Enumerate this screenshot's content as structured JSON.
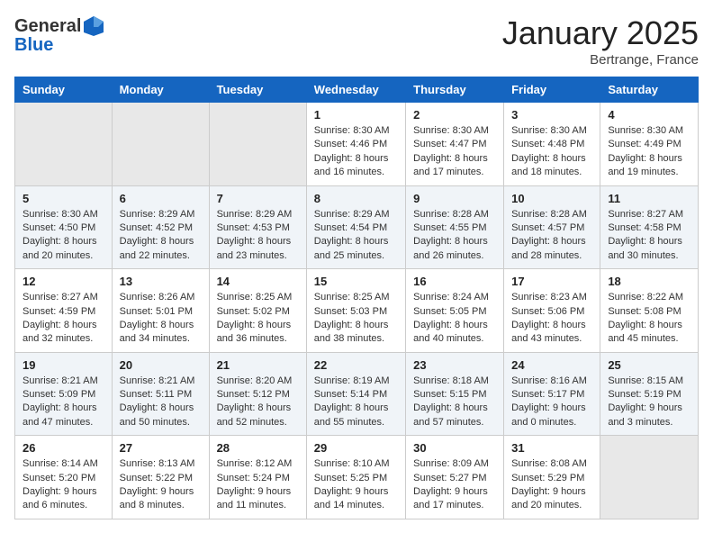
{
  "header": {
    "logo_general": "General",
    "logo_blue": "Blue",
    "month": "January 2025",
    "location": "Bertrange, France"
  },
  "weekdays": [
    "Sunday",
    "Monday",
    "Tuesday",
    "Wednesday",
    "Thursday",
    "Friday",
    "Saturday"
  ],
  "weeks": [
    [
      {
        "day": "",
        "info": ""
      },
      {
        "day": "",
        "info": ""
      },
      {
        "day": "",
        "info": ""
      },
      {
        "day": "1",
        "info": "Sunrise: 8:30 AM\nSunset: 4:46 PM\nDaylight: 8 hours\nand 16 minutes."
      },
      {
        "day": "2",
        "info": "Sunrise: 8:30 AM\nSunset: 4:47 PM\nDaylight: 8 hours\nand 17 minutes."
      },
      {
        "day": "3",
        "info": "Sunrise: 8:30 AM\nSunset: 4:48 PM\nDaylight: 8 hours\nand 18 minutes."
      },
      {
        "day": "4",
        "info": "Sunrise: 8:30 AM\nSunset: 4:49 PM\nDaylight: 8 hours\nand 19 minutes."
      }
    ],
    [
      {
        "day": "5",
        "info": "Sunrise: 8:30 AM\nSunset: 4:50 PM\nDaylight: 8 hours\nand 20 minutes."
      },
      {
        "day": "6",
        "info": "Sunrise: 8:29 AM\nSunset: 4:52 PM\nDaylight: 8 hours\nand 22 minutes."
      },
      {
        "day": "7",
        "info": "Sunrise: 8:29 AM\nSunset: 4:53 PM\nDaylight: 8 hours\nand 23 minutes."
      },
      {
        "day": "8",
        "info": "Sunrise: 8:29 AM\nSunset: 4:54 PM\nDaylight: 8 hours\nand 25 minutes."
      },
      {
        "day": "9",
        "info": "Sunrise: 8:28 AM\nSunset: 4:55 PM\nDaylight: 8 hours\nand 26 minutes."
      },
      {
        "day": "10",
        "info": "Sunrise: 8:28 AM\nSunset: 4:57 PM\nDaylight: 8 hours\nand 28 minutes."
      },
      {
        "day": "11",
        "info": "Sunrise: 8:27 AM\nSunset: 4:58 PM\nDaylight: 8 hours\nand 30 minutes."
      }
    ],
    [
      {
        "day": "12",
        "info": "Sunrise: 8:27 AM\nSunset: 4:59 PM\nDaylight: 8 hours\nand 32 minutes."
      },
      {
        "day": "13",
        "info": "Sunrise: 8:26 AM\nSunset: 5:01 PM\nDaylight: 8 hours\nand 34 minutes."
      },
      {
        "day": "14",
        "info": "Sunrise: 8:25 AM\nSunset: 5:02 PM\nDaylight: 8 hours\nand 36 minutes."
      },
      {
        "day": "15",
        "info": "Sunrise: 8:25 AM\nSunset: 5:03 PM\nDaylight: 8 hours\nand 38 minutes."
      },
      {
        "day": "16",
        "info": "Sunrise: 8:24 AM\nSunset: 5:05 PM\nDaylight: 8 hours\nand 40 minutes."
      },
      {
        "day": "17",
        "info": "Sunrise: 8:23 AM\nSunset: 5:06 PM\nDaylight: 8 hours\nand 43 minutes."
      },
      {
        "day": "18",
        "info": "Sunrise: 8:22 AM\nSunset: 5:08 PM\nDaylight: 8 hours\nand 45 minutes."
      }
    ],
    [
      {
        "day": "19",
        "info": "Sunrise: 8:21 AM\nSunset: 5:09 PM\nDaylight: 8 hours\nand 47 minutes."
      },
      {
        "day": "20",
        "info": "Sunrise: 8:21 AM\nSunset: 5:11 PM\nDaylight: 8 hours\nand 50 minutes."
      },
      {
        "day": "21",
        "info": "Sunrise: 8:20 AM\nSunset: 5:12 PM\nDaylight: 8 hours\nand 52 minutes."
      },
      {
        "day": "22",
        "info": "Sunrise: 8:19 AM\nSunset: 5:14 PM\nDaylight: 8 hours\nand 55 minutes."
      },
      {
        "day": "23",
        "info": "Sunrise: 8:18 AM\nSunset: 5:15 PM\nDaylight: 8 hours\nand 57 minutes."
      },
      {
        "day": "24",
        "info": "Sunrise: 8:16 AM\nSunset: 5:17 PM\nDaylight: 9 hours\nand 0 minutes."
      },
      {
        "day": "25",
        "info": "Sunrise: 8:15 AM\nSunset: 5:19 PM\nDaylight: 9 hours\nand 3 minutes."
      }
    ],
    [
      {
        "day": "26",
        "info": "Sunrise: 8:14 AM\nSunset: 5:20 PM\nDaylight: 9 hours\nand 6 minutes."
      },
      {
        "day": "27",
        "info": "Sunrise: 8:13 AM\nSunset: 5:22 PM\nDaylight: 9 hours\nand 8 minutes."
      },
      {
        "day": "28",
        "info": "Sunrise: 8:12 AM\nSunset: 5:24 PM\nDaylight: 9 hours\nand 11 minutes."
      },
      {
        "day": "29",
        "info": "Sunrise: 8:10 AM\nSunset: 5:25 PM\nDaylight: 9 hours\nand 14 minutes."
      },
      {
        "day": "30",
        "info": "Sunrise: 8:09 AM\nSunset: 5:27 PM\nDaylight: 9 hours\nand 17 minutes."
      },
      {
        "day": "31",
        "info": "Sunrise: 8:08 AM\nSunset: 5:29 PM\nDaylight: 9 hours\nand 20 minutes."
      },
      {
        "day": "",
        "info": ""
      }
    ]
  ]
}
